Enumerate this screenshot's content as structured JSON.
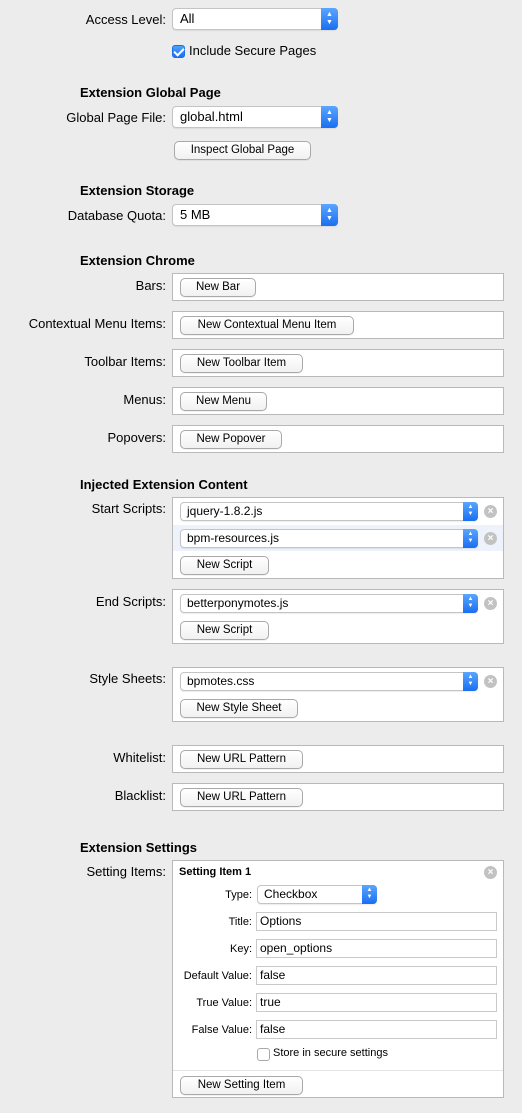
{
  "access": {
    "label": "Access Level:",
    "value": "All",
    "secure_label": "Include Secure Pages",
    "secure_checked": true
  },
  "global_page": {
    "heading": "Extension Global Page",
    "file_label": "Global Page File:",
    "file_value": "global.html",
    "inspect_button": "Inspect Global Page"
  },
  "storage": {
    "heading": "Extension Storage",
    "quota_label": "Database Quota:",
    "quota_value": "5 MB"
  },
  "chrome": {
    "heading": "Extension Chrome",
    "bars_label": "Bars:",
    "bars_button": "New Bar",
    "context_label": "Contextual Menu Items:",
    "context_button": "New Contextual Menu Item",
    "toolbar_label": "Toolbar Items:",
    "toolbar_button": "New Toolbar Item",
    "menus_label": "Menus:",
    "menus_button": "New Menu",
    "popovers_label": "Popovers:",
    "popovers_button": "New Popover"
  },
  "injected": {
    "heading": "Injected Extension Content",
    "start_label": "Start Scripts:",
    "start_scripts": [
      "jquery-1.8.2.js",
      "bpm-resources.js"
    ],
    "start_button": "New Script",
    "end_label": "End Scripts:",
    "end_scripts": [
      "betterponymotes.js"
    ],
    "end_button": "New Script",
    "style_label": "Style Sheets:",
    "style_sheets": [
      "bpmotes.css"
    ],
    "style_button": "New Style Sheet",
    "whitelist_label": "Whitelist:",
    "whitelist_button": "New URL Pattern",
    "blacklist_label": "Blacklist:",
    "blacklist_button": "New URL Pattern"
  },
  "settings": {
    "heading": "Extension Settings",
    "items_label": "Setting Items:",
    "item_title": "Setting Item 1",
    "type_label": "Type:",
    "type_value": "Checkbox",
    "title_label": "Title:",
    "title_value": "Options",
    "key_label": "Key:",
    "key_value": "open_options",
    "default_label": "Default Value:",
    "default_value": "false",
    "true_label": "True Value:",
    "true_value": "true",
    "false_label": "False Value:",
    "false_value": "false",
    "secure_label": "Store in secure settings",
    "secure_checked": false,
    "new_button": "New Setting Item"
  },
  "colors": {
    "accent": "#1a6ff1",
    "background": "#ececec",
    "remove_icon": "#c2c2c2"
  }
}
